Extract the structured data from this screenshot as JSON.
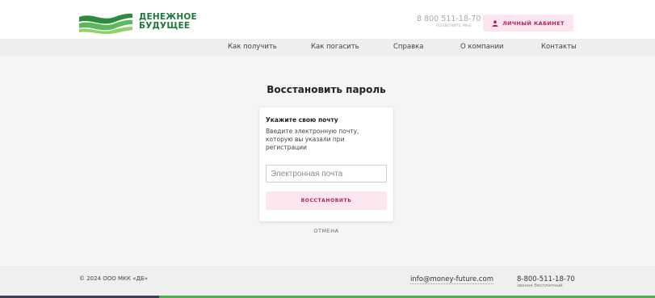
{
  "colors": {
    "brand_green": "#1e7a3c",
    "accent_pink": "#b01f5b",
    "accent_pink_bg": "#fbe6ef",
    "progress_dark": "#3b3f54",
    "progress_green": "#4caf50"
  },
  "header": {
    "logo_line1": "ДЕНЕЖНОЕ",
    "logo_line2": "БУДУЩЕЕ",
    "phone": "8 800 511-18-70",
    "phone_callback": "ПОЗВОНИТЕ МНЕ",
    "cabinet_label": "ЛИЧНЫЙ КАБИНЕТ",
    "cabinet_icon": "user-icon"
  },
  "nav": {
    "items": [
      {
        "label": "Как получить"
      },
      {
        "label": "Как погасить"
      },
      {
        "label": "Справка"
      },
      {
        "label": "О компании"
      },
      {
        "label": "Контакты"
      }
    ]
  },
  "main": {
    "title": "Восстановить пароль",
    "card": {
      "heading": "Укажите свою почту",
      "description": "Введите электронную почту, которую вы указали при регистрации",
      "email_value": "",
      "email_placeholder": "Электронная почта",
      "submit_label": "ВОССТАНОВИТЬ"
    },
    "cancel_label": "ОТМЕНА"
  },
  "footer": {
    "copyright": "© 2024 ООО МКК «ДБ»",
    "email": "info@money-future.com",
    "phone": "8-800-511-18-70",
    "phone_note": "звонок бесплатный"
  }
}
